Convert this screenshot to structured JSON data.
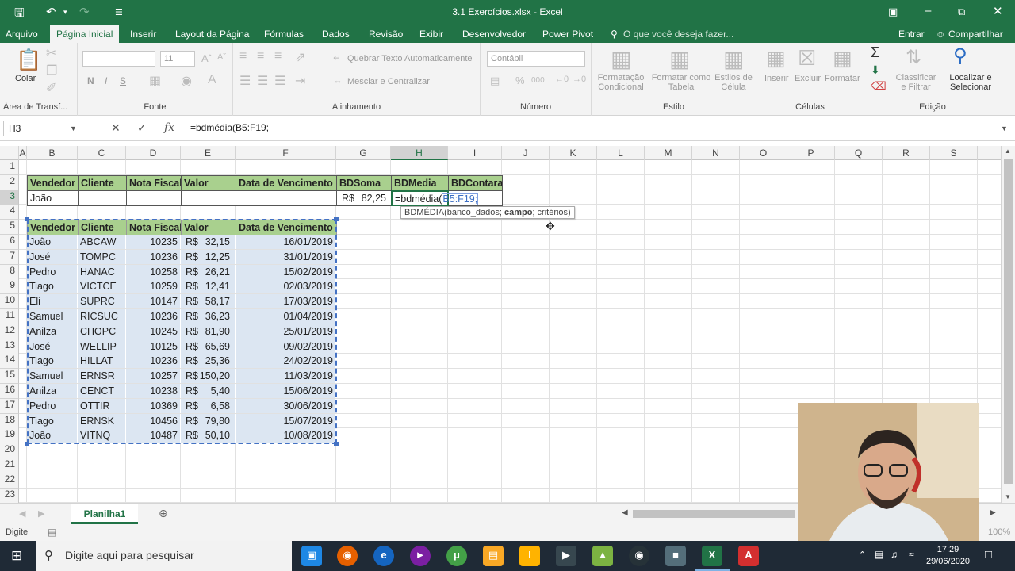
{
  "window": {
    "title": "3.1 Exercícios.xlsx - Excel"
  },
  "ribbon_tabs": [
    "Arquivo",
    "Página Inicial",
    "Inserir",
    "Layout da Página",
    "Fórmulas",
    "Dados",
    "Revisão",
    "Exibir",
    "Desenvolvedor",
    "Power Pivot"
  ],
  "tell_me": "O que você deseja fazer...",
  "account": {
    "signin": "Entrar",
    "share": "Compartilhar"
  },
  "ribbon": {
    "clipboard": {
      "paste": "Colar",
      "label": "Área de Transf..."
    },
    "font": {
      "size": "11",
      "bold": "N",
      "italic": "I",
      "underline": "S",
      "label": "Fonte"
    },
    "alignment": {
      "wrap": "Quebrar Texto Automaticamente",
      "merge": "Mesclar e Centralizar",
      "label": "Alinhamento"
    },
    "number": {
      "format": "Contábil",
      "label": "Número"
    },
    "styles": {
      "conditional": "Formatação Condicional",
      "as_table": "Formatar como Tabela",
      "cell_styles": "Estilos de Célula",
      "label": "Estilo"
    },
    "cells": {
      "insert": "Inserir",
      "delete": "Excluir",
      "format": "Formatar",
      "label": "Células"
    },
    "editing": {
      "sort": "Classificar e Filtrar",
      "find": "Localizar e Selecionar",
      "label": "Edição"
    }
  },
  "formula_bar": {
    "name_box": "H3",
    "formula": "=bdmédia(B5:F19;"
  },
  "columns": [
    "A",
    "B",
    "C",
    "D",
    "E",
    "F",
    "G",
    "H",
    "I",
    "J",
    "K",
    "L",
    "M",
    "N",
    "O",
    "P",
    "Q",
    "R",
    "S"
  ],
  "rows": [
    "1",
    "2",
    "3",
    "4",
    "5",
    "6",
    "7",
    "8",
    "9",
    "10",
    "11",
    "12",
    "13",
    "14",
    "15",
    "16",
    "17",
    "18",
    "19",
    "20",
    "21",
    "22",
    "23"
  ],
  "criteria": {
    "headers": [
      "Vendedor",
      "Cliente",
      "Nota Fiscal",
      "Valor",
      "Data de Vencimento",
      "BDSoma",
      "BDMedia",
      "BDContara"
    ],
    "vendedor": "João",
    "bdsoma_currency": "R$",
    "bdsoma_value": "82,25",
    "editing_prefix": "=bdmédia(",
    "editing_ref": "B5:F19;"
  },
  "tooltip": {
    "prefix": "BDMÉDIA(banco_dados; ",
    "bold": "campo",
    "suffix": "; critérios)"
  },
  "table": {
    "headers": [
      "Vendedor",
      "Cliente",
      "Nota Fiscal",
      "Valor",
      "Data de Vencimento"
    ],
    "rows": [
      [
        "João",
        "ABCAW",
        "10235",
        "32,15",
        "16/01/2019"
      ],
      [
        "José",
        "TOMPC",
        "10236",
        "12,25",
        "31/01/2019"
      ],
      [
        "Pedro",
        "HANAC",
        "10258",
        "26,21",
        "15/02/2019"
      ],
      [
        "Tiago",
        "VICTCE",
        "10259",
        "12,41",
        "02/03/2019"
      ],
      [
        "Eli",
        "SUPRC",
        "10147",
        "58,17",
        "17/03/2019"
      ],
      [
        "Samuel",
        "RICSUC",
        "10236",
        "36,23",
        "01/04/2019"
      ],
      [
        "Anilza",
        "CHOPC",
        "10245",
        "81,90",
        "25/01/2019"
      ],
      [
        "José",
        "WELLIP",
        "10125",
        "65,69",
        "09/02/2019"
      ],
      [
        "Tiago",
        "HILLAT",
        "10236",
        "25,36",
        "24/02/2019"
      ],
      [
        "Samuel",
        "ERNSR",
        "10257",
        "150,20",
        "11/03/2019"
      ],
      [
        "Anilza",
        "CENCT",
        "10238",
        "5,40",
        "15/06/2019"
      ],
      [
        "Pedro",
        "OTTIR",
        "10369",
        "6,58",
        "30/06/2019"
      ],
      [
        "Tiago",
        "ERNSK",
        "10456",
        "79,80",
        "15/07/2019"
      ],
      [
        "João",
        "VITNQ",
        "10487",
        "50,10",
        "10/08/2019"
      ]
    ],
    "currency": "R$"
  },
  "sheet": {
    "tab": "Planilha1"
  },
  "status": {
    "mode": "Digite",
    "zoom": "100%"
  },
  "taskbar": {
    "search_placeholder": "Digite aqui para pesquisar",
    "time": "17:29",
    "date": "29/06/2020"
  },
  "colors": {
    "excel_green": "#217346",
    "header_fill": "#a9d08e",
    "table_fill": "#dce6f2",
    "selection": "#4472c4"
  }
}
